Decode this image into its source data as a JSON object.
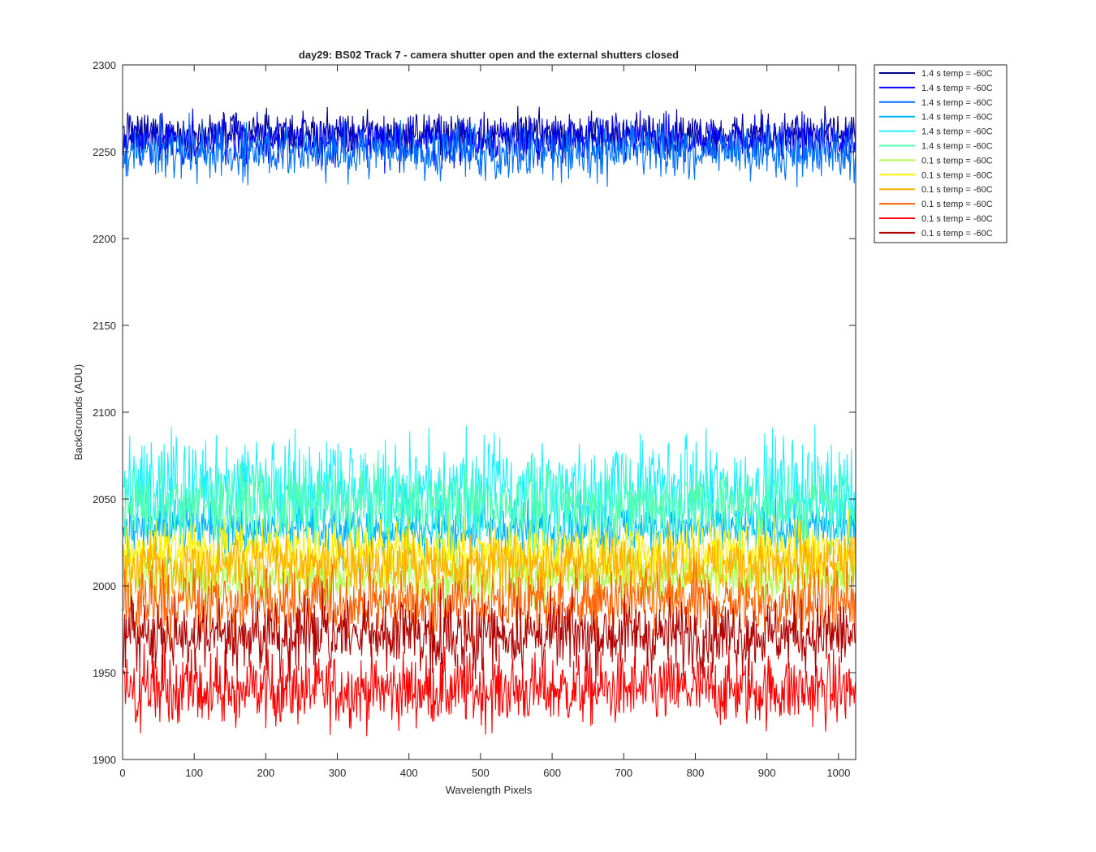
{
  "chart_data": {
    "type": "line",
    "title": "day29: BS02  Track 7 - camera shutter open and the external shutters closed",
    "xlabel": "Wavelength Pixels",
    "ylabel": "BackGrounds (ADU)",
    "xlim": [
      0,
      1024
    ],
    "ylim": [
      1900,
      2300
    ],
    "xticks": [
      0,
      100,
      200,
      300,
      400,
      500,
      600,
      700,
      800,
      900,
      1000
    ],
    "yticks": [
      1900,
      1950,
      2000,
      2050,
      2100,
      2150,
      2200,
      2250,
      2300
    ],
    "n_points": 1024,
    "grid": false,
    "legend_position": "outside-top-right",
    "series": [
      {
        "name": "1.4 s temp = -60C",
        "color": "#00008f",
        "mean": 2260,
        "amplitude": 10
      },
      {
        "name": "1.4 s temp = -60C",
        "color": "#0000ff",
        "mean": 2257,
        "amplitude": 11
      },
      {
        "name": "1.4 s temp = -60C",
        "color": "#0070ff",
        "mean": 2250,
        "amplitude": 12
      },
      {
        "name": "1.4 s temp = -60C",
        "color": "#00b4ff",
        "mean": 2033,
        "amplitude": 13
      },
      {
        "name": "1.4 s temp = -60C",
        "color": "#20efff",
        "mean": 2055,
        "amplitude": 24
      },
      {
        "name": "1.4 s temp = -60C",
        "color": "#50ffaf",
        "mean": 2047,
        "amplitude": 18
      },
      {
        "name": "0.1 s temp = -60C",
        "color": "#afff50",
        "mean": 2005,
        "amplitude": 13
      },
      {
        "name": "0.1 s temp = -60C",
        "color": "#ffef00",
        "mean": 2020,
        "amplitude": 14
      },
      {
        "name": "0.1 s temp = -60C",
        "color": "#ffaf00",
        "mean": 2012,
        "amplitude": 14
      },
      {
        "name": "0.1 s temp = -60C",
        "color": "#ff6000",
        "mean": 1990,
        "amplitude": 16
      },
      {
        "name": "0.1 s temp = -60C",
        "color": "#ff0000",
        "mean": 1940,
        "amplitude": 17
      },
      {
        "name": "0.1 s temp = -60C",
        "color": "#b00000",
        "mean": 1972,
        "amplitude": 17
      }
    ]
  }
}
